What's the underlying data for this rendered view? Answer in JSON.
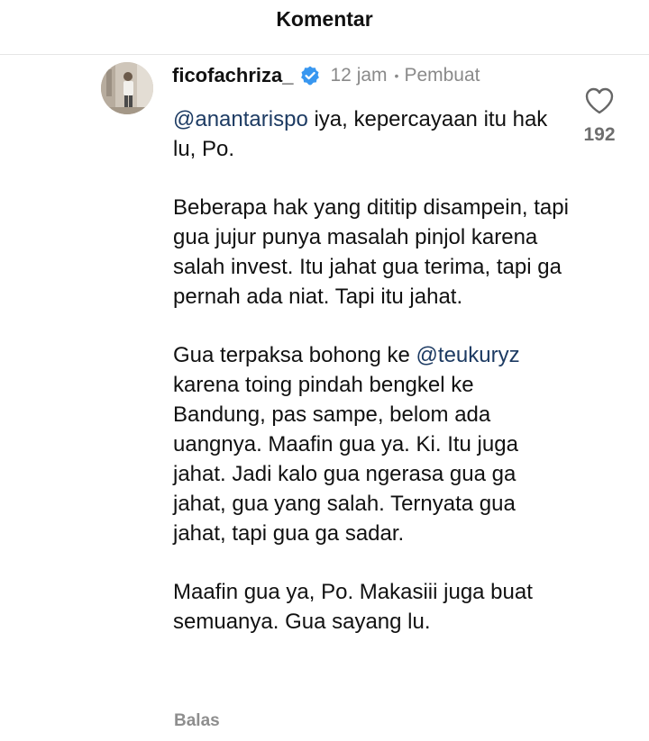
{
  "header": {
    "title": "Komentar"
  },
  "comment": {
    "username": "ficofachriza_",
    "verified_icon": "verified-badge-icon",
    "time": "12 jam",
    "separator": "•",
    "role": "Pembuat",
    "paragraphs": [
      [
        {
          "text": "@anantarispo",
          "mention": true
        },
        {
          "text": " iya, kepercayaan itu hak lu, Po.",
          "mention": false
        }
      ],
      [
        {
          "text": "Beberapa hak yang dititip disampein, tapi gua jujur punya masalah pinjol karena salah invest. Itu jahat gua terima, tapi ga pernah ada niat. Tapi itu jahat.",
          "mention": false
        }
      ],
      [
        {
          "text": "Gua terpaksa bohong ke ",
          "mention": false
        },
        {
          "text": "@teukuryz",
          "mention": true
        },
        {
          "text": " karena toing pindah bengkel ke Bandung, pas sampe, belom ada uangnya. Maafin gua ya. Ki. Itu juga jahat. Jadi kalo gua ngerasa gua ga jahat, gua yang salah. Ternyata gua jahat, tapi gua ga sadar.",
          "mention": false
        }
      ],
      [
        {
          "text": "Maafin gua ya, Po. Makasiii juga buat semuanya. Gua sayang lu.",
          "mention": false
        }
      ]
    ],
    "like_icon": "heart-outline-icon",
    "like_count": "192",
    "reply_label": "Balas"
  },
  "colors": {
    "mention": "#1d3b63",
    "verified": "#3897f0",
    "muted": "#8a8a8a"
  }
}
